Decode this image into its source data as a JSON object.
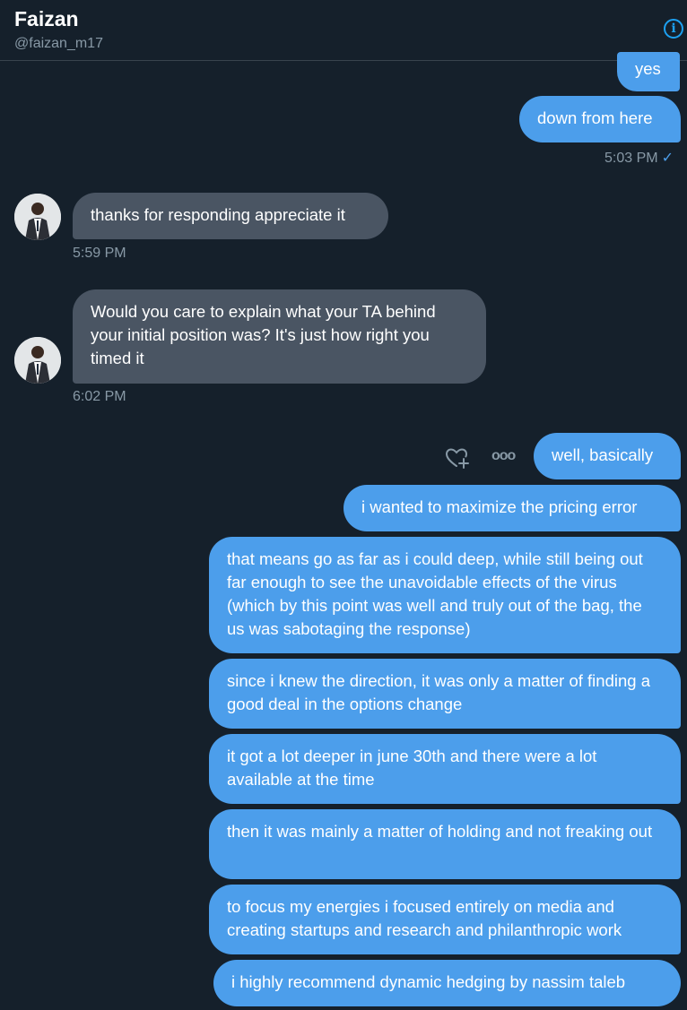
{
  "header": {
    "name": "Faizan",
    "handle": "@faizan_m17",
    "info_icon": "info-icon"
  },
  "messages": [
    {
      "text": "yes"
    },
    {
      "text": "down from here",
      "time": "5:03 PM"
    },
    {
      "text": "thanks for responding appreciate it",
      "time": "5:59 PM"
    },
    {
      "text": "Would you care to explain what your TA behind your initial position was? It's just how right you timed it",
      "time": "6:02 PM"
    },
    {
      "text": "well, basically"
    },
    {
      "text": "i wanted to maximize the pricing error"
    },
    {
      "text": "that means go as far as i could deep, while still being out far enough to see the unavoidable effects of the virus (which by this point was well and truly out of the bag, the us was sabotaging the response)"
    },
    {
      "text": "since i knew the direction, it was only a matter of finding a good deal in the options change"
    },
    {
      "text": "it got a lot deeper in june 30th and there were a lot available at the time"
    },
    {
      "text": "then it was mainly a matter of holding and not freaking out"
    },
    {
      "text": "to focus my energies i focused entirely on media and creating startups and research and philanthropic work"
    },
    {
      "text": "i highly recommend dynamic hedging by nassim taleb"
    }
  ],
  "read_mark": "✓",
  "more_glyph": "ooo",
  "colors": {
    "background": "#15202b",
    "outgoing_bubble": "#4c9eeb",
    "incoming_bubble": "#4a5563",
    "muted_text": "#8899a6",
    "accent": "#1da1f2"
  }
}
